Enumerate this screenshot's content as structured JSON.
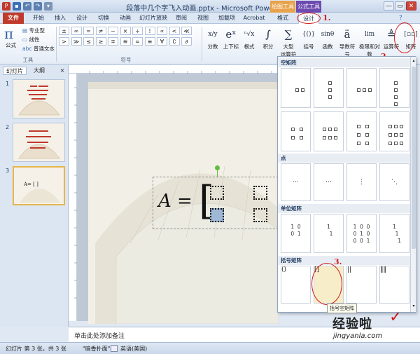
{
  "window": {
    "title": "段落中几个字飞入动画.pptx - Microsoft PowerPoint",
    "context_header_drawing": "绘图工具",
    "context_header_formula": "公式工具",
    "minimize": "—",
    "maximize": "▭",
    "close": "✕"
  },
  "tabs": [
    "文件",
    "开始",
    "插入",
    "设计",
    "切换",
    "动画",
    "幻灯片放映",
    "审阅",
    "视图",
    "加载项",
    "Acrobat",
    "格式",
    "设计"
  ],
  "ribbon": {
    "tools": {
      "group_label": "工具",
      "formula_label": "公式",
      "professional": "专业型",
      "linear": "线性",
      "normal_text": "普通文本"
    },
    "symbols": {
      "group_label": "符号",
      "row1": [
        "±",
        "∞",
        "=",
        "≠",
        "~",
        "×",
        "÷",
        "!",
        "∝",
        "<",
        "≪"
      ],
      "row2": [
        ">",
        "≫",
        "≤",
        "≥",
        "∓",
        "≅",
        "≈",
        "≡",
        "∀",
        "∁",
        "∂"
      ]
    },
    "structures": [
      {
        "glyph": "x/y",
        "label": "分数"
      },
      {
        "glyph": "eˣ",
        "label": "上下标"
      },
      {
        "glyph": "ⁿ√x",
        "label": "根式"
      },
      {
        "glyph": "∫",
        "label": "积分"
      },
      {
        "glyph": "∑",
        "label": "大型\n运算符"
      },
      {
        "glyph": "{()}",
        "label": "括号"
      },
      {
        "glyph": "sinθ",
        "label": "函数"
      },
      {
        "glyph": "ä",
        "label": "导数符号"
      },
      {
        "glyph": "lim",
        "label": "极限和对数"
      },
      {
        "glyph": "≜",
        "label": "运算符"
      },
      {
        "glyph": "[▫▫]",
        "label": "矩阵"
      }
    ]
  },
  "left_pane": {
    "tab_slides": "幻灯片",
    "tab_outline": "大纲",
    "close": "×",
    "slides": [
      {
        "num": "1"
      },
      {
        "num": "2"
      },
      {
        "num": "3",
        "text": "A= [ ]"
      }
    ]
  },
  "slide": {
    "equation_lhs": "A =",
    "bracket_left": "[",
    "bracket_right": "]"
  },
  "dropdown": {
    "sections": [
      {
        "title": "空矩阵"
      },
      {
        "title": "点"
      },
      {
        "title": "单位矩阵"
      },
      {
        "title": "括号矩阵"
      }
    ],
    "identity": [
      [
        "1  0",
        "0  1"
      ],
      [
        "1",
        "   1"
      ],
      [
        "1  0  0",
        "0  1  0",
        "0  0  1"
      ],
      [
        "1",
        "   1",
        "      1"
      ]
    ],
    "dots": [
      "···",
      "⋯",
      "⋮",
      "⋱"
    ],
    "tooltip": "括号空矩阵"
  },
  "annotations": {
    "step1": "1.",
    "step2": "2.",
    "step3": "3."
  },
  "notes": {
    "placeholder": "单击此处添加备注"
  },
  "status": {
    "slide_info": "幻灯片 第 3 张，共 3 张",
    "theme": "\"暗香扑面\"",
    "language": "英语(美国)"
  },
  "watermark": {
    "text": "经验啦",
    "check": "✓",
    "url": "jingyanla.com"
  },
  "colors": {
    "accent_red": "#d31d1d",
    "file_tab": "#c0392b",
    "drawing_tools": "#e8a24a",
    "formula_tools": "#6e4bb0"
  }
}
